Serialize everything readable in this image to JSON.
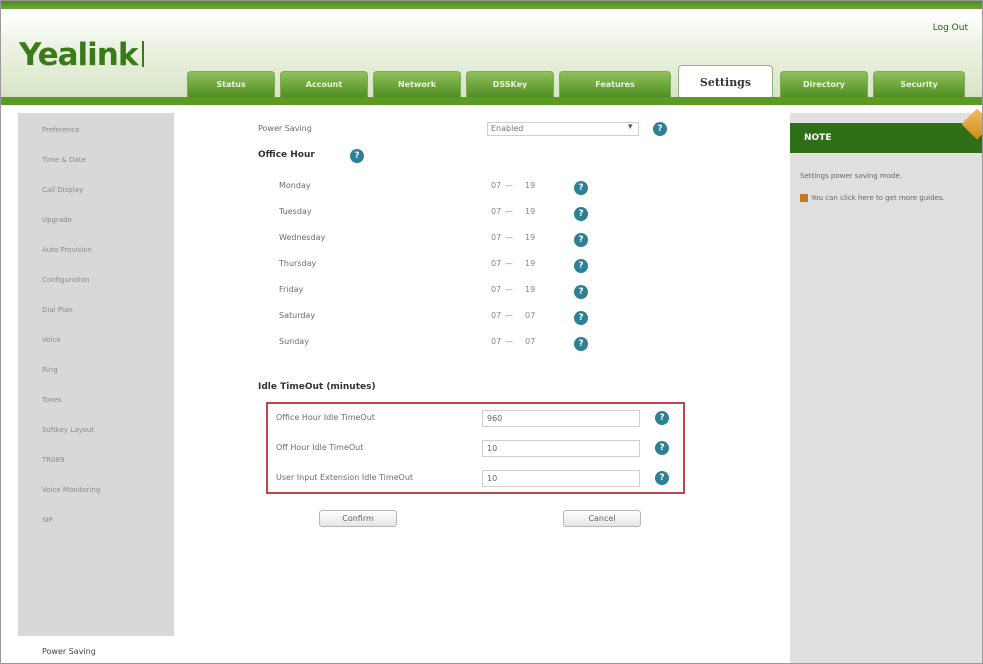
{
  "header": {
    "logo": "Yealink",
    "logo_sub": "",
    "logout": "Log Out",
    "tabs": [
      {
        "label": "Status"
      },
      {
        "label": "Account"
      },
      {
        "label": "Network"
      },
      {
        "label": "DSSKey"
      },
      {
        "label": "Features"
      },
      {
        "label": "Settings",
        "active": true
      },
      {
        "label": "Directory"
      },
      {
        "label": "Security"
      }
    ]
  },
  "sidebar": {
    "items": [
      {
        "label": "Preference"
      },
      {
        "label": "Time & Date"
      },
      {
        "label": "Call Display"
      },
      {
        "label": "Upgrade"
      },
      {
        "label": "Auto Provision"
      },
      {
        "label": "Configuration"
      },
      {
        "label": "Dial Plan"
      },
      {
        "label": "Voice"
      },
      {
        "label": "Ring"
      },
      {
        "label": "Tones"
      },
      {
        "label": "Softkey Layout"
      },
      {
        "label": "TR069"
      },
      {
        "label": "Voice Monitoring"
      },
      {
        "label": "SIP"
      },
      {
        "label": "Power Saving",
        "active": true
      }
    ]
  },
  "main": {
    "power_saving": {
      "label": "Power Saving",
      "value": "Enabled"
    },
    "office_hour": {
      "title": "Office Hour",
      "days": [
        {
          "label": "Monday",
          "from": "07",
          "to": "19"
        },
        {
          "label": "Tuesday",
          "from": "07",
          "to": "19"
        },
        {
          "label": "Wednesday",
          "from": "07",
          "to": "19"
        },
        {
          "label": "Thursday",
          "from": "07",
          "to": "19"
        },
        {
          "label": "Friday",
          "from": "07",
          "to": "19"
        },
        {
          "label": "Saturday",
          "from": "07",
          "to": "07"
        },
        {
          "label": "Sunday",
          "from": "07",
          "to": "07"
        }
      ],
      "separator": "—"
    },
    "idle_timeout": {
      "title": "Idle TimeOut (minutes)",
      "fields": [
        {
          "label": "Office Hour Idle TimeOut",
          "value": "960"
        },
        {
          "label": "Off Hour Idle TimeOut",
          "value": "10"
        },
        {
          "label": "User Input Extension Idle TimeOut",
          "value": "10"
        }
      ]
    },
    "confirm_label": "Confirm",
    "cancel_label": "Cancel",
    "help_glyph": "?"
  },
  "note": {
    "title": "NOTE",
    "line1": "Settings power saving mode.",
    "line2": "You can click here to get more guides."
  }
}
